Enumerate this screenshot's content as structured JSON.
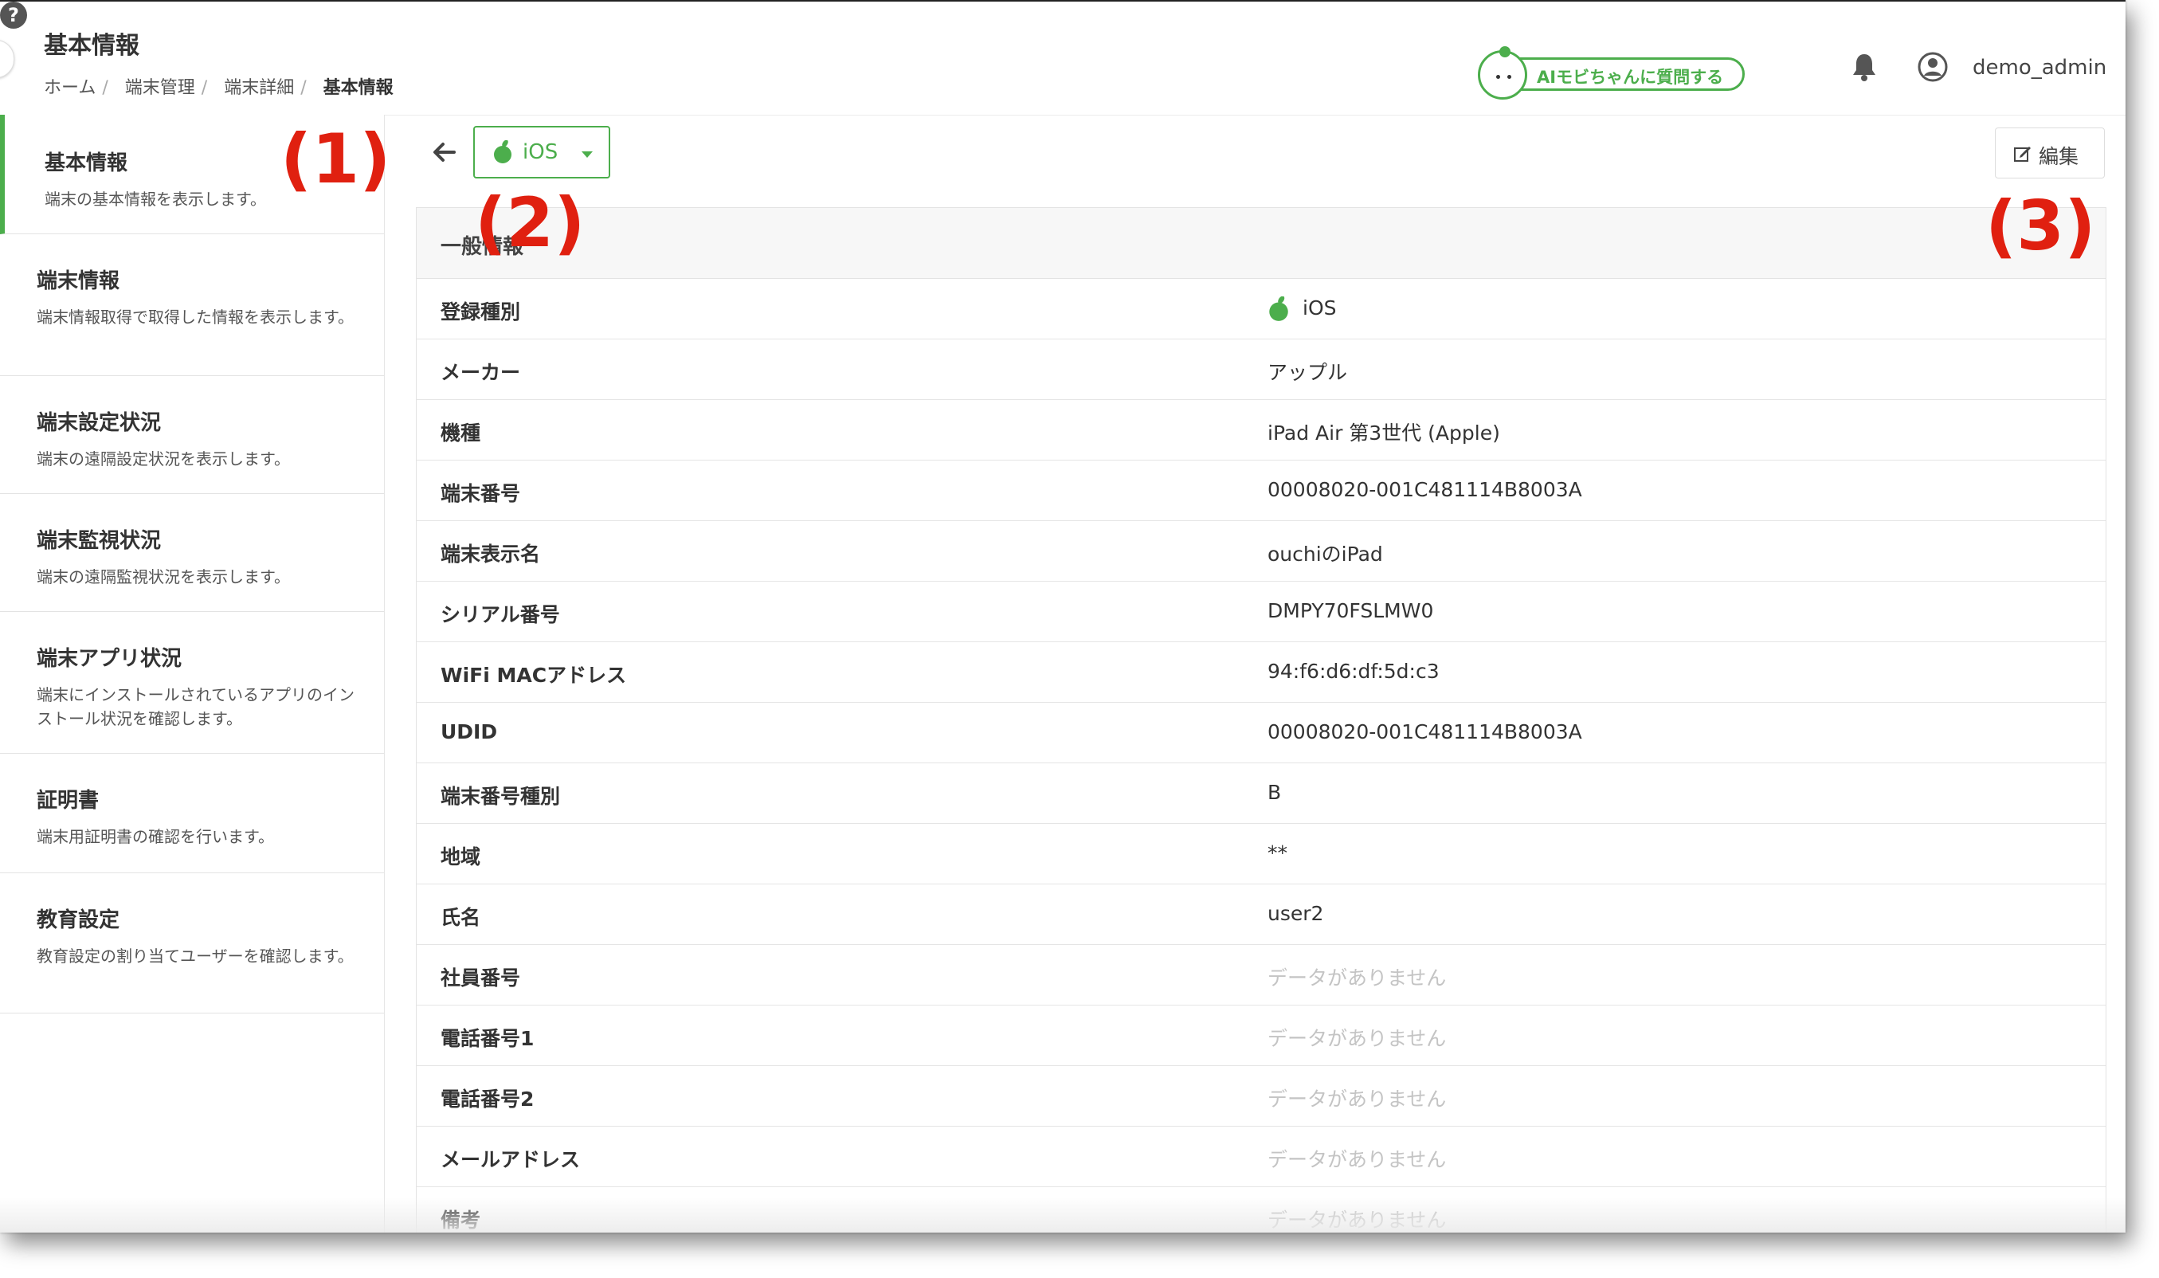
{
  "header": {
    "title": "基本情報",
    "breadcrumb": [
      "ホーム",
      "端末管理",
      "端末詳細",
      "基本情報"
    ],
    "ai_button_label": "AIモビちゃんに質問する",
    "username": "demo_admin",
    "icons": [
      "help-icon",
      "bell-icon",
      "user-circle-icon"
    ]
  },
  "sidebar": {
    "items": [
      {
        "title": "基本情報",
        "desc": "端末の基本情報を表示します。",
        "active": true
      },
      {
        "title": "端末情報",
        "desc": "端末情報取得で取得した情報を表示します。",
        "active": false
      },
      {
        "title": "端末設定状況",
        "desc": "端末の遠隔設定状況を表示します。",
        "active": false
      },
      {
        "title": "端末監視状況",
        "desc": "端末の遠隔監視状況を表示します。",
        "active": false
      },
      {
        "title": "端末アプリ状況",
        "desc": "端末にインストールされているアプリのインストール状況を確認します。",
        "active": false
      },
      {
        "title": "証明書",
        "desc": "端末用証明書の確認を行います。",
        "active": false
      },
      {
        "title": "教育設定",
        "desc": "教育設定の割り当てユーザーを確認します。",
        "active": false
      }
    ]
  },
  "toolbar": {
    "os_selected": "iOS",
    "edit_label": "編集"
  },
  "annotations": [
    "(1)",
    "(2)",
    "(3)"
  ],
  "panel": {
    "title": "一般情報",
    "rows": [
      {
        "label": "登録種別",
        "value": "iOS",
        "icon": "apple-icon"
      },
      {
        "label": "メーカー",
        "value": "アップル"
      },
      {
        "label": "機種",
        "value": "iPad Air 第3世代 (Apple)"
      },
      {
        "label": "端末番号",
        "value": "00008020-001C481114B8003A"
      },
      {
        "label": "端末表示名",
        "value": "ouchiのiPad"
      },
      {
        "label": "シリアル番号",
        "value": "DMPY70FSLMW0"
      },
      {
        "label": "WiFi MACアドレス",
        "value": "94:f6:d6:df:5d:c3"
      },
      {
        "label": "UDID",
        "value": "00008020-001C481114B8003A"
      },
      {
        "label": "端末番号種別",
        "value": "B"
      },
      {
        "label": "地域",
        "value": "**"
      },
      {
        "label": "氏名",
        "value": "user2"
      },
      {
        "label": "社員番号",
        "value": "データがありません",
        "empty": true
      },
      {
        "label": "電話番号1",
        "value": "データがありません",
        "empty": true
      },
      {
        "label": "電話番号2",
        "value": "データがありません",
        "empty": true
      },
      {
        "label": "メールアドレス",
        "value": "データがありません",
        "empty": true
      },
      {
        "label": "備考",
        "value": "データがありません",
        "empty": true
      }
    ]
  },
  "colors": {
    "accent": "#4cae4c",
    "annotation": "#e02010",
    "empty_text": "#c4c4c4"
  }
}
